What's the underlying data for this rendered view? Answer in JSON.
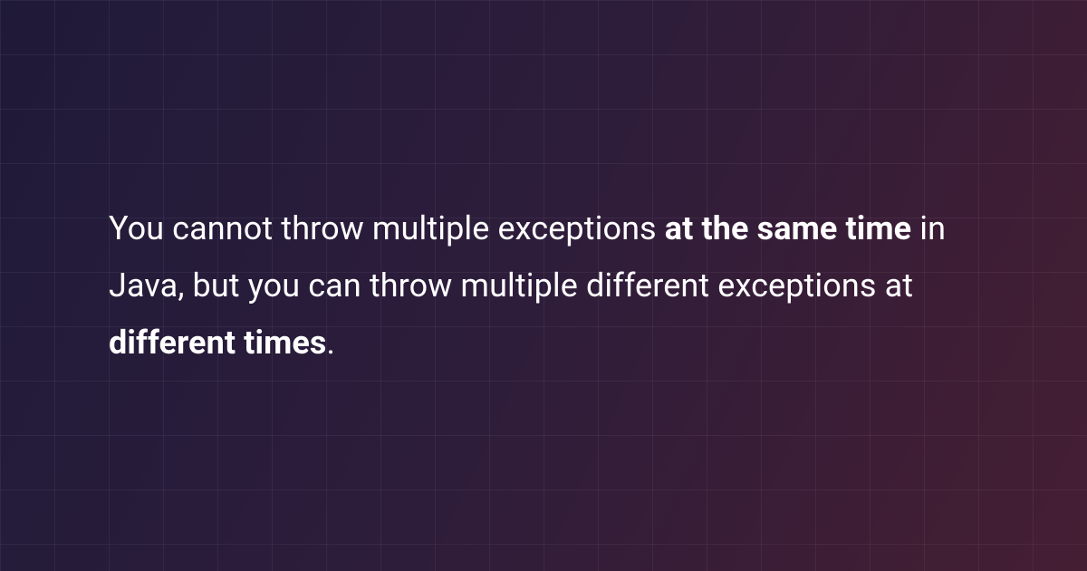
{
  "quote": {
    "segments": [
      {
        "text": "You cannot throw multiple exceptions ",
        "bold": false
      },
      {
        "text": "at the same time",
        "bold": true
      },
      {
        "text": " in Java, but you can throw multiple different exceptions at ",
        "bold": false
      },
      {
        "text": "different times",
        "bold": true
      },
      {
        "text": ".",
        "bold": false
      }
    ]
  }
}
